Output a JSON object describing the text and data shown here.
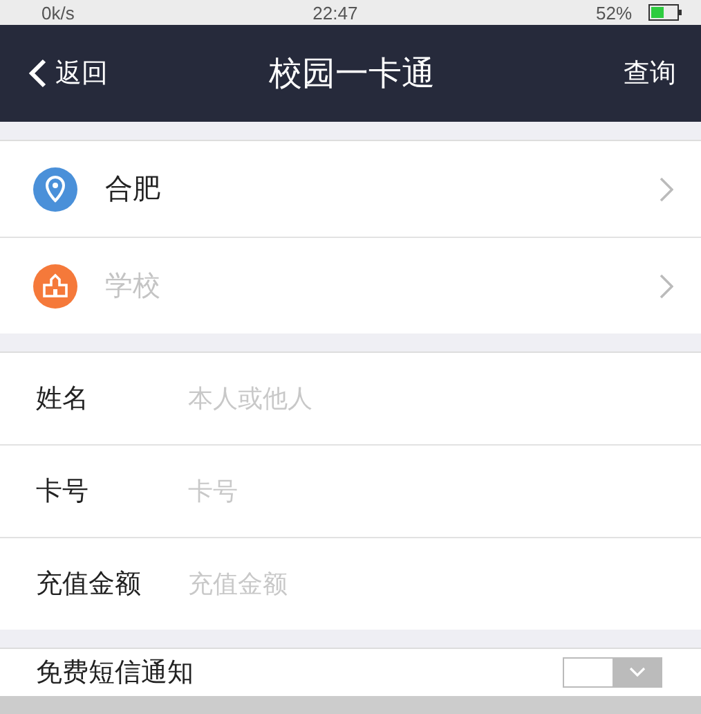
{
  "status_bar": {
    "speed": "0k/s",
    "time": "22:47",
    "battery": "52%"
  },
  "nav": {
    "back": "返回",
    "title": "校园一卡通",
    "action": "查询"
  },
  "location_rows": [
    {
      "kind": "city",
      "value": "合肥",
      "placeholder": false
    },
    {
      "kind": "school",
      "value": "学校",
      "placeholder": true
    }
  ],
  "form_fields": [
    {
      "label": "姓名",
      "placeholder": "本人或他人"
    },
    {
      "label": "卡号",
      "placeholder": "卡号"
    },
    {
      "label": "充值金额",
      "placeholder": "充值金额"
    }
  ],
  "sms_notice": {
    "label": "免费短信通知",
    "on": false
  }
}
